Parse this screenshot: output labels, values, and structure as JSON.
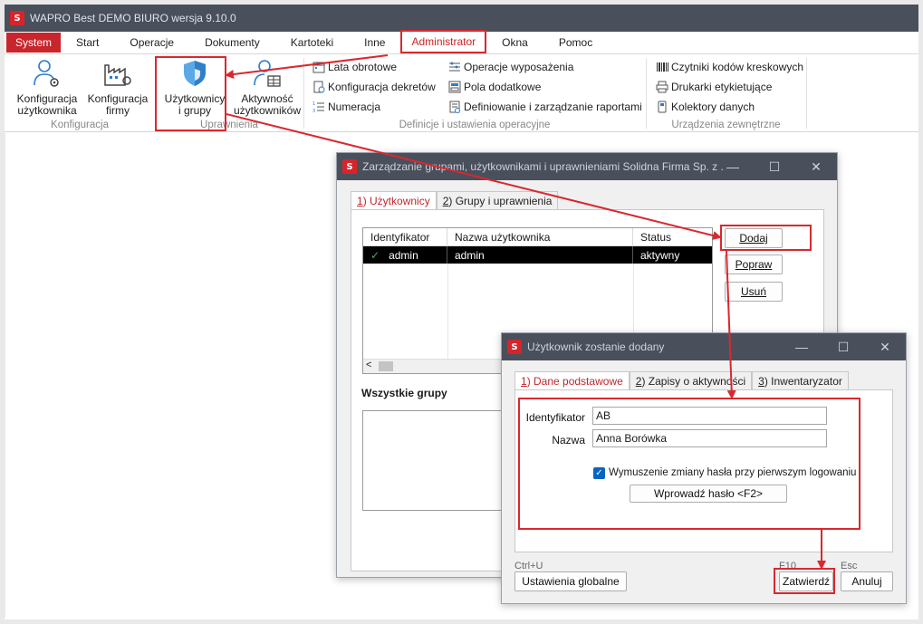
{
  "window": {
    "title": "WAPRO Best DEMO BIURO wersja 9.10.0"
  },
  "menu": [
    "System",
    "Start",
    "Operacje",
    "Dokumenty",
    "Kartoteki",
    "Inne",
    "Administrator",
    "Okna",
    "Pomoc"
  ],
  "ribbon": {
    "konfiguracja": {
      "label": "Konfiguracja",
      "btn1_l1": "Konfiguracja",
      "btn1_l2": "użytkownika",
      "btn2_l1": "Konfiguracja",
      "btn2_l2": "firmy"
    },
    "uprawnienia": {
      "label": "Uprawnienia",
      "btn1_l1": "Użytkownicy",
      "btn1_l2": "i grupy",
      "btn2_l1": "Aktywność",
      "btn2_l2": "użytkowników"
    },
    "definicje": {
      "label": "Definicje i ustawienia operacyjne",
      "items": [
        "Lata obrotowe",
        "Konfiguracja dekretów",
        "Numeracja",
        "Operacje wyposażenia",
        "Pola dodatkowe",
        "Definiowanie i zarządzanie raportami"
      ]
    },
    "urzadzenia": {
      "label": "Urządzenia zewnętrzne",
      "items": [
        "Czytniki kodów kreskowych",
        "Drukarki etykietujące",
        "Kolektory danych"
      ]
    }
  },
  "dialog1": {
    "title": "Zarządzanie grupami, użytkownikami i uprawnieniami Solidna Firma Sp. z ...",
    "tab1": {
      "num": "1",
      "rest": ") Użytkownicy"
    },
    "tab2": {
      "num": "2",
      "rest": ") Grupy i uprawnienia"
    },
    "columns": [
      "Identyfikator",
      "Nazwa użytkownika",
      "Status"
    ],
    "rows": [
      {
        "id": "admin",
        "name": "admin",
        "status": "aktywny"
      }
    ],
    "btn_add": "Dodaj",
    "btn_edit": "Popraw",
    "btn_delete": "Usuń",
    "all_groups": "Wszystkie grupy"
  },
  "dialog2": {
    "title": "Użytkownik zostanie dodany",
    "tab1": {
      "num": "1",
      "rest": ") Dane podstawowe"
    },
    "tab2": {
      "num": "2",
      "rest": ") Zapisy o aktywności"
    },
    "tab3": {
      "num": "3",
      "rest": ") Inwentaryzator"
    },
    "id_label": "Identyfikator",
    "id_value": "AB",
    "name_label": "Nazwa",
    "name_value": "Anna Borówka",
    "force_pw_label": "Wymuszenie zmiany hasła przy pierwszym logowaniu",
    "force_pw_checked": true,
    "btn_password": "Wprowadź hasło <F2>",
    "shortcut_global": "Ctrl+U",
    "btn_global": "Ustawienia globalne",
    "shortcut_ok": "F10",
    "btn_ok": "Zatwierdź",
    "shortcut_cancel": "Esc",
    "btn_cancel": "Anuluj"
  },
  "colors": {
    "accent_red": "#d9282f",
    "titlebar": "#4a4f5c",
    "link_blue": "#0b63c4"
  }
}
